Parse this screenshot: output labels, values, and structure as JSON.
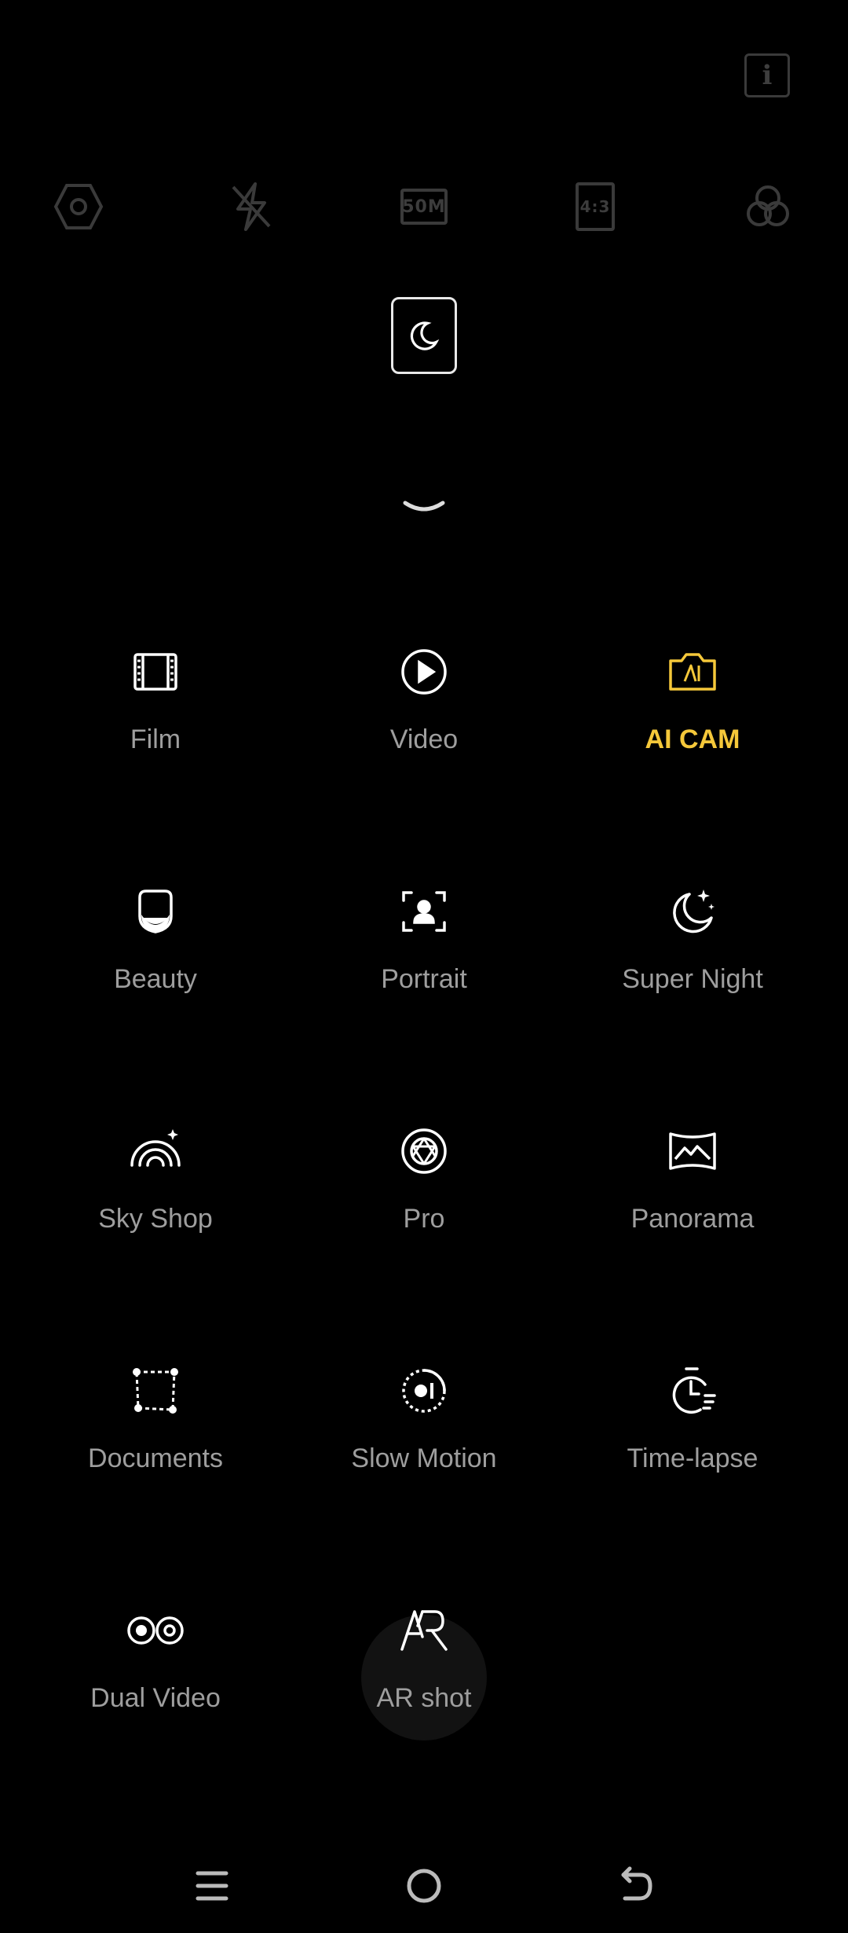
{
  "top": {
    "info_icon": "info-icon",
    "info_glyph": "i"
  },
  "toolbar": {
    "settings_icon": "hexagon-settings-icon",
    "flash_icon": "flash-off-icon",
    "resolution_label": "50M",
    "ratio_label": "4:3",
    "filter_icon": "filter-circles-icon"
  },
  "night_toggle": {
    "icon": "moon-icon"
  },
  "collapse": {
    "icon": "chevron-down-icon"
  },
  "modes": [
    {
      "label": "Film",
      "icon": "film-icon",
      "active": false
    },
    {
      "label": "Video",
      "icon": "play-icon",
      "active": false
    },
    {
      "label": "AI CAM",
      "icon": "ai-camera-icon",
      "active": true
    },
    {
      "label": "Beauty",
      "icon": "beauty-face-icon",
      "active": false
    },
    {
      "label": "Portrait",
      "icon": "portrait-icon",
      "active": false
    },
    {
      "label": "Super Night",
      "icon": "moon-stars-icon",
      "active": false
    },
    {
      "label": "Sky Shop",
      "icon": "rainbow-icon",
      "active": false
    },
    {
      "label": "Pro",
      "icon": "aperture-icon",
      "active": false
    },
    {
      "label": "Panorama",
      "icon": "panorama-icon",
      "active": false
    },
    {
      "label": "Documents",
      "icon": "document-scan-icon",
      "active": false
    },
    {
      "label": "Slow Motion",
      "icon": "slow-motion-icon",
      "active": false
    },
    {
      "label": "Time-lapse",
      "icon": "timer-icon",
      "active": false
    },
    {
      "label": "Dual Video",
      "icon": "dual-video-icon",
      "active": false
    },
    {
      "label": "AR shot",
      "icon": "ar-icon",
      "active": false
    }
  ],
  "colors": {
    "active": "#f5c83a",
    "label": "#9e9e9e",
    "icon": "#ffffff"
  },
  "nav": {
    "menu_icon": "menu-icon",
    "home_icon": "home-icon",
    "back_icon": "back-icon"
  }
}
